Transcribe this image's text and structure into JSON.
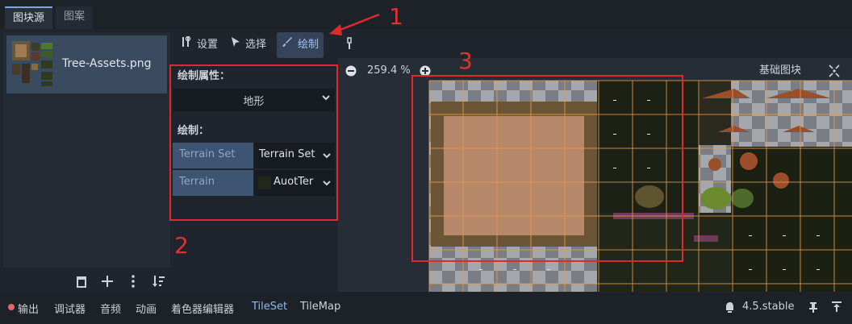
{
  "tabs": [
    {
      "label": "图块源"
    },
    {
      "label": "图案"
    }
  ],
  "source": {
    "file_name": "Tree-Assets.png"
  },
  "toolbar": {
    "setup_label": "设置",
    "select_label": "选择",
    "paint_label": "绘制"
  },
  "paint": {
    "properties_title": "绘制属性：",
    "property_value": "地形",
    "section_title": "绘制：",
    "terrain_set_label": "Terrain Set",
    "terrain_set_value": "Terrain Set",
    "terrain_label": "Terrain",
    "terrain_value": "AuotTer"
  },
  "atlas": {
    "zoom": "259.4 %",
    "base_tiles_label": "基础图块"
  },
  "annotations": {
    "one": "1",
    "two": "2",
    "three": "3"
  },
  "bottom": {
    "output": "输出",
    "debugger": "调试器",
    "audio": "音频",
    "animation": "动画",
    "shader_editor": "着色器编辑器",
    "tileset": "TileSet",
    "tilemap": "TileMap",
    "version": "4.5.stable"
  },
  "colors": {
    "accent": "#7aa5e6",
    "annotation_red": "#e02a2a",
    "selected_item": "#3a4a5f",
    "tileset_active": "#8fb8f0"
  }
}
